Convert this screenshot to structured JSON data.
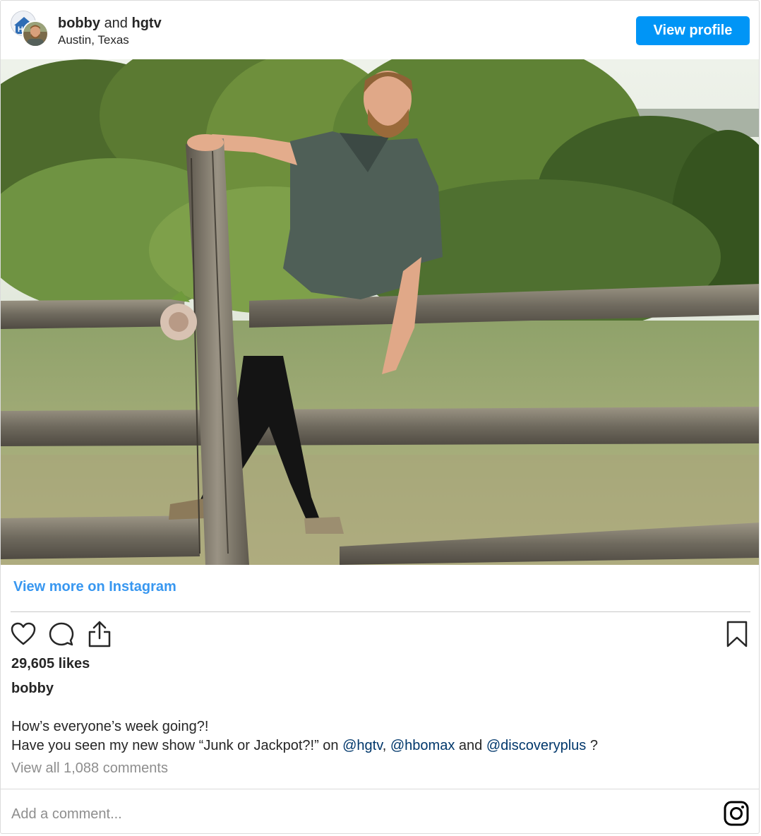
{
  "header": {
    "user1": "bobby",
    "joiner": "and",
    "user2": "hgtv",
    "location": "Austin, Texas",
    "view_profile_label": "View profile",
    "avatar1_text": "HG"
  },
  "photo": {
    "description_icon": "post-photo"
  },
  "view_more_label": "View more on Instagram",
  "actions": {
    "like_icon": "heart-icon",
    "comment_icon": "comment-bubble-icon",
    "share_icon": "share-icon",
    "save_icon": "bookmark-icon"
  },
  "likes_text": "29,605 likes",
  "caption": {
    "username": "bobby",
    "line1": "How’s everyone’s week going?!",
    "line2_prefix": "Have you seen my new show “Junk or Jackpot?!” on ",
    "mention1": "@hgtv",
    "sep1": ", ",
    "mention2": "@hbomax",
    "sep2": " and ",
    "mention3": "@discoveryplus",
    "suffix": " ?"
  },
  "comments_link": "View all 1,088 comments",
  "add_comment_placeholder": "Add a comment...",
  "colors": {
    "accent": "#0095f6",
    "link": "#3897f0",
    "mention": "#00376b",
    "muted": "#8e8e8e"
  }
}
